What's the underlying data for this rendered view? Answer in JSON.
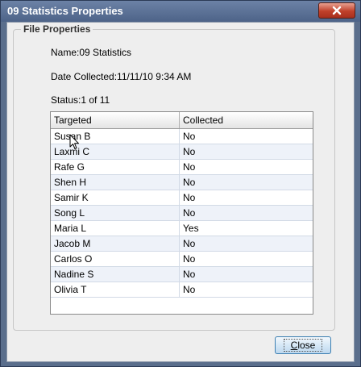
{
  "window": {
    "title": "09 Statistics Properties",
    "close_icon": "close-x-icon"
  },
  "group": {
    "legend": "File Properties"
  },
  "properties": {
    "name": "Name:09 Statistics",
    "date_collected": "Date Collected:11/11/10 9:34 AM",
    "status": "Status:1 of 11"
  },
  "table": {
    "columns": [
      "Targeted",
      "Collected"
    ],
    "rows": [
      {
        "targeted": "Susan B",
        "collected": "No"
      },
      {
        "targeted": "Laxmi C",
        "collected": "No"
      },
      {
        "targeted": "Rafe G",
        "collected": "No"
      },
      {
        "targeted": "Shen H",
        "collected": "No"
      },
      {
        "targeted": "Samir K",
        "collected": "No"
      },
      {
        "targeted": "Song L",
        "collected": "No"
      },
      {
        "targeted": "Maria L",
        "collected": "Yes"
      },
      {
        "targeted": "Jacob M",
        "collected": "No"
      },
      {
        "targeted": "Carlos O",
        "collected": "No"
      },
      {
        "targeted": "Nadine S",
        "collected": "No"
      },
      {
        "targeted": "Olivia T",
        "collected": "No"
      }
    ]
  },
  "buttons": {
    "close_label_accel": "C",
    "close_label_rest": "lose"
  },
  "colors": {
    "titlebar": "#5a6e8c",
    "dialog_bg": "#eeeeee",
    "close_button_red": "#c0402a",
    "button_border": "#3c7fb1"
  }
}
